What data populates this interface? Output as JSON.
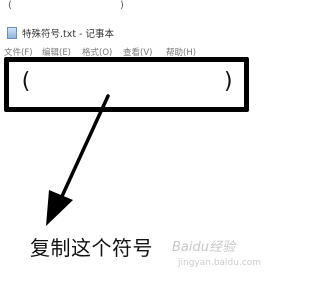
{
  "snippet": {
    "left_paren": "(",
    "right_paren": ")"
  },
  "window": {
    "title": "特殊符号.txt - 记事本"
  },
  "menu": {
    "file": "文件(F)",
    "edit": "编辑(E)",
    "format": "格式(O)",
    "view": "查看(V)",
    "help": "帮助(H)"
  },
  "editor": {
    "left_paren": "(",
    "right_paren": ")"
  },
  "annotation": {
    "caption": "复制这个符号"
  },
  "watermark": {
    "brand": "Baidu经验",
    "url": "jingyan.baidu.com"
  },
  "colors": {
    "frame": "#000000",
    "background": "#ffffff"
  }
}
